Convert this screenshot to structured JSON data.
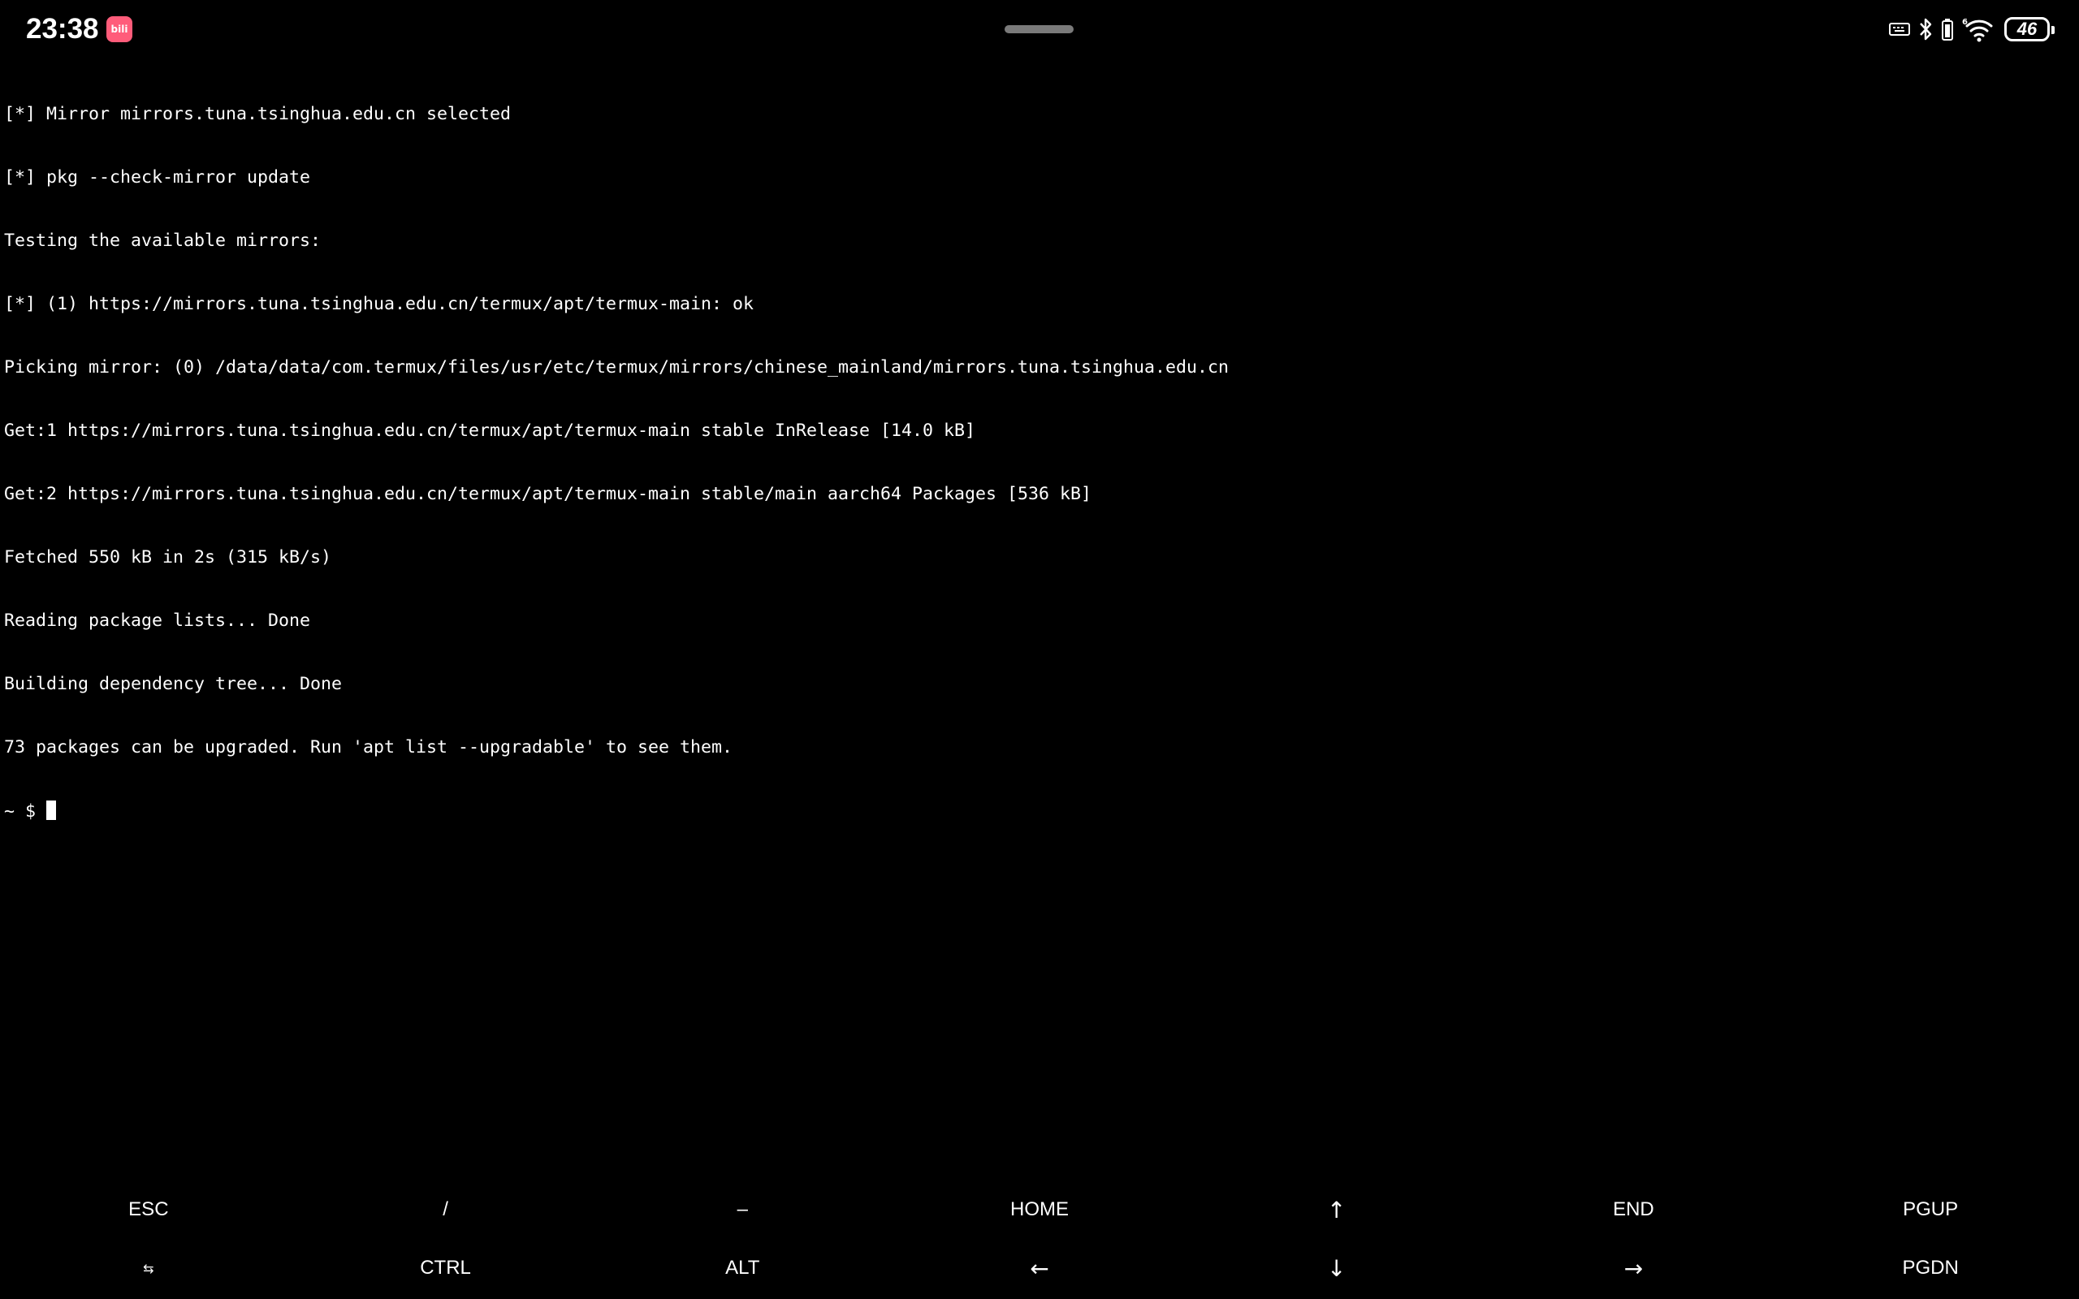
{
  "status_bar": {
    "time": "23:38",
    "app_badge_text": "bili",
    "app_badge_color": "#ff5c7a",
    "icons": [
      "keyboard-icon",
      "bluetooth-icon",
      "battery-saver-icon",
      "wifi-6-icon"
    ],
    "wifi_label": "6",
    "battery_level": "46"
  },
  "terminal": {
    "lines": [
      "[*] Mirror mirrors.tuna.tsinghua.edu.cn selected",
      "[*] pkg --check-mirror update",
      "Testing the available mirrors:",
      "[*] (1) https://mirrors.tuna.tsinghua.edu.cn/termux/apt/termux-main: ok",
      "Picking mirror: (0) /data/data/com.termux/files/usr/etc/termux/mirrors/chinese_mainland/mirrors.tuna.tsinghua.edu.cn",
      "Get:1 https://mirrors.tuna.tsinghua.edu.cn/termux/apt/termux-main stable InRelease [14.0 kB]",
      "Get:2 https://mirrors.tuna.tsinghua.edu.cn/termux/apt/termux-main stable/main aarch64 Packages [536 kB]",
      "Fetched 550 kB in 2s (315 kB/s)",
      "Reading package lists... Done",
      "Building dependency tree... Done",
      "73 packages can be upgraded. Run 'apt list --upgradable' to see them."
    ],
    "prompt": "~ $ "
  },
  "extra_keys": {
    "row1": [
      {
        "label": "ESC",
        "name": "key-esc"
      },
      {
        "label": "/",
        "name": "key-slash"
      },
      {
        "label": "–",
        "name": "key-dash"
      },
      {
        "label": "HOME",
        "name": "key-home"
      },
      {
        "label": "↑",
        "name": "key-up"
      },
      {
        "label": "END",
        "name": "key-end"
      },
      {
        "label": "PGUP",
        "name": "key-pgup"
      }
    ],
    "row2": [
      {
        "label": "⇆",
        "name": "key-tab"
      },
      {
        "label": "CTRL",
        "name": "key-ctrl"
      },
      {
        "label": "ALT",
        "name": "key-alt"
      },
      {
        "label": "←",
        "name": "key-left"
      },
      {
        "label": "↓",
        "name": "key-down"
      },
      {
        "label": "→",
        "name": "key-right"
      },
      {
        "label": "PGDN",
        "name": "key-pgdn"
      }
    ]
  },
  "colors": {
    "background": "#000000",
    "foreground": "#ffffff"
  }
}
